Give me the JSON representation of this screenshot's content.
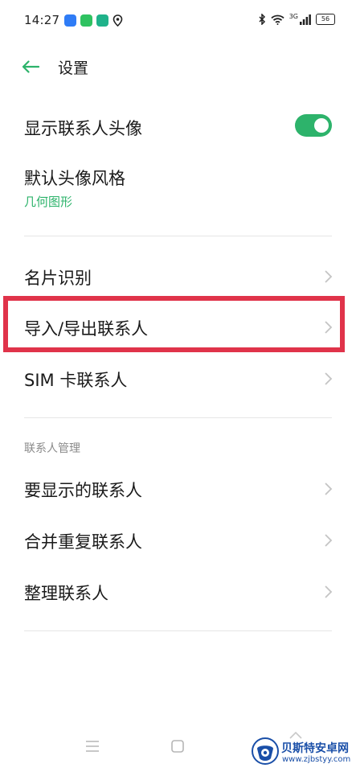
{
  "status_bar": {
    "time": "14:27",
    "network_label": "3G",
    "battery_level": "56"
  },
  "header": {
    "title": "设置"
  },
  "rows": {
    "show_avatar": {
      "label": "显示联系人头像",
      "toggle_on": true
    },
    "avatar_style": {
      "label": "默认头像风格",
      "value": "几何图形"
    },
    "card_recognition": {
      "label": "名片识别"
    },
    "import_export": {
      "label": "导入/导出联系人"
    },
    "sim_contacts": {
      "label": "SIM 卡联系人"
    }
  },
  "contacts_management": {
    "header": "联系人管理",
    "items": [
      {
        "label": "要显示的联系人"
      },
      {
        "label": "合并重复联系人"
      },
      {
        "label": "整理联系人"
      }
    ]
  },
  "watermark": {
    "title": "贝斯特安卓网",
    "url": "www.zjbstyy.com"
  },
  "colors": {
    "accent": "#2db36b",
    "highlight": "#e0334a"
  }
}
